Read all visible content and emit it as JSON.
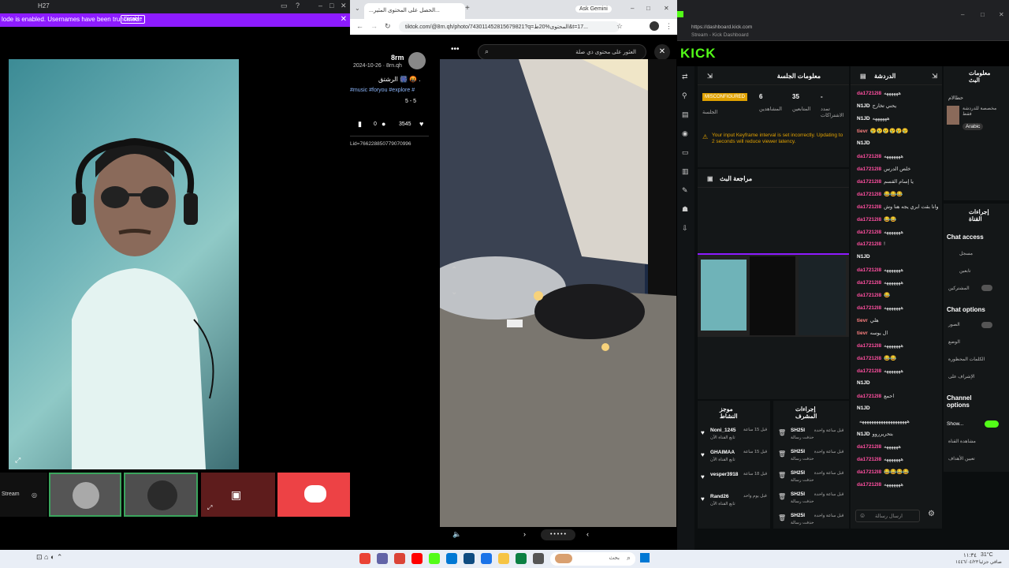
{
  "left": {
    "title": "H27",
    "banner_text": "lode is enabled. Usernames have been truncated.",
    "banner_button": "Disable",
    "stream_label": "Stream"
  },
  "tiktok": {
    "tab_title": "...الحصل على المحتوى المثير...",
    "tab_gemini": "Ask Gemini",
    "url": "tiktok.com/@8rn.qh/photo/743011452815679821?q=المحتوى%20ط&t=17...",
    "username": "8rm",
    "date": "2024-10-26 · 8rn.qh",
    "caption": "الرشتق 🎆 🤬 .",
    "hashtags": "#music #foryou #explore #",
    "slides": "5 - 5",
    "likes": "3545",
    "comments": "0",
    "id_text": "Lid=766228850779070996",
    "search_placeholder": "العثور على محتوى ذي صلة"
  },
  "kick": {
    "addr": "https://dashboard.kick.com",
    "addr_sub": "Stream - Kick Dashboard",
    "logo": "KICK",
    "session_title": "معلومات الجلسة",
    "misconfigured": "MISCONFIGURED",
    "stat1_val": "6",
    "stat1_label": "المشاهدين",
    "stat2_val": "35",
    "stat2_label": "المتابعين",
    "stat3_val": "-",
    "stat3_label": "تمدد الاشتراكات",
    "session_label": "الجلسة",
    "warning": "Your input Keyframe interval is set incorrectly. Updating to 2 seconds will reduce viewer latency.",
    "preview_title": "مراجعة البث",
    "chat_title": "الدردشة",
    "chat_input_placeholder": "ارسال رسالة",
    "chat": [
      {
        "user": "da17212I8",
        "text": "ههههههه",
        "cls": "u1"
      },
      {
        "user": "N1JD",
        "text": "يحني تخارج",
        "cls": "u2"
      },
      {
        "user": "N1JD",
        "text": "ههههههه",
        "cls": "u2"
      },
      {
        "user": "tievr",
        "text": "😢😢😢😢😢😢",
        "cls": "u3"
      },
      {
        "user": "N1JD",
        "text": "",
        "cls": "u2"
      },
      {
        "user": "da17212I8",
        "text": "هههههههه",
        "cls": "u1"
      },
      {
        "user": "da17212I8",
        "text": "خلص الدرس",
        "cls": "u1"
      },
      {
        "user": "da17212I8",
        "text": "يا إسام القسم",
        "cls": "u1"
      },
      {
        "user": "da17212I8",
        "text": "😂😂😂",
        "cls": "u1"
      },
      {
        "user": "da17212I8",
        "text": "وانا بقت ابري يجه هنا وش",
        "cls": "u1"
      },
      {
        "user": "da17212I8",
        "text": "😂😂",
        "cls": "u1"
      },
      {
        "user": "da17212I8",
        "text": "هههههههه",
        "cls": "u1"
      },
      {
        "user": "da17212I8",
        "text": "!",
        "cls": "u1"
      },
      {
        "user": "N1JD",
        "text": "",
        "cls": "u2"
      },
      {
        "user": "da17212I8",
        "text": "هههههههه",
        "cls": "u1"
      },
      {
        "user": "da17212I8",
        "text": "هههههههه",
        "cls": "u1"
      },
      {
        "user": "da17212I8",
        "text": "😂",
        "cls": "u1"
      },
      {
        "user": "da17212I8",
        "text": "هههههههه",
        "cls": "u1"
      },
      {
        "user": "tievr",
        "text": "هلي",
        "cls": "u3"
      },
      {
        "user": "tievr",
        "text": "ال يوسه",
        "cls": "u3"
      },
      {
        "user": "da17212I8",
        "text": "هههههههه",
        "cls": "u1"
      },
      {
        "user": "da17212I8",
        "text": "😂😂",
        "cls": "u1"
      },
      {
        "user": "da17212I8",
        "text": "هههههههه",
        "cls": "u1"
      },
      {
        "user": "N1JD",
        "text": "",
        "cls": "u2"
      },
      {
        "user": "da17212I8",
        "text": "احمع",
        "cls": "u1"
      },
      {
        "user": "N1JD",
        "text": "",
        "cls": "u2"
      },
      {
        "user": "",
        "text": "ههههههههههههههههههههه",
        "cls": "u2"
      },
      {
        "user": "N1JD",
        "text": "بتحريرروو",
        "cls": "u2"
      },
      {
        "user": "da17212I8",
        "text": "ههههههه",
        "cls": "u1"
      },
      {
        "user": "da17212I8",
        "text": "هههههههه",
        "cls": "u1"
      },
      {
        "user": "da17212I8",
        "text": "😂😂😂😂",
        "cls": "u1"
      },
      {
        "user": "da17212I8",
        "text": "هههههههه",
        "cls": "u1"
      }
    ],
    "stream_info_title": "معلومات البث",
    "stream_info_sub": "مخصصة للدردشة فقط",
    "stream_info_tag": "Arabic",
    "stream_info_name": "حطالام",
    "mod_title": "إجراءات القناة",
    "chat_access": "Chat access",
    "chat_options": "Chat options",
    "channel_options": "Channel options",
    "show_label": "Show...",
    "opt1": "مسجل",
    "opt2": "تابعين",
    "opt3": "المشتركين",
    "opt4": "الصور",
    "opt5": "الوضع",
    "opt6": "الكلمات المحظورة",
    "opt7": "الإشراف على",
    "opt8": "مشاهدة القناة",
    "opt9": "تعيين الأهداف",
    "events_title": "موجز النشاط",
    "actions_title": "إجراءات المشرف",
    "events": [
      {
        "name": "Noni_1245",
        "sub": "تابع القناة الآن",
        "time": "قبل 15 ساعة"
      },
      {
        "name": "GHAIMAA",
        "sub": "تابع القناة الآن",
        "time": "قبل 15 ساعة"
      },
      {
        "name": "vesper3918",
        "sub": "",
        "time": "قبل 18 ساعة"
      },
      {
        "name": "Rand26",
        "sub": "تابع القناة الآن",
        "time": "قبل يوم واحد"
      }
    ],
    "actions": [
      {
        "name": "SH25I",
        "sub": "حذفت رسالة",
        "time": "قبل ساعة واحدة"
      },
      {
        "name": "SH25I",
        "sub": "حذفت رسالة",
        "time": "قبل ساعة واحدة"
      },
      {
        "name": "SH25I",
        "sub": "حذفت رسالة",
        "time": "قبل ساعة واحدة"
      },
      {
        "name": "SH25I",
        "sub": "حذفت رسالة",
        "time": "قبل ساعة واحدة"
      },
      {
        "name": "SH25I",
        "sub": "حذفت رسالة",
        "time": "قبل ساعة واحدة"
      }
    ]
  },
  "taskbar": {
    "search": "بحث",
    "temp": "31°C",
    "weather": "صافي جزئيا",
    "time": "١١:٣٤",
    "date": "١٤٤٦/٠٤/٢٣"
  }
}
